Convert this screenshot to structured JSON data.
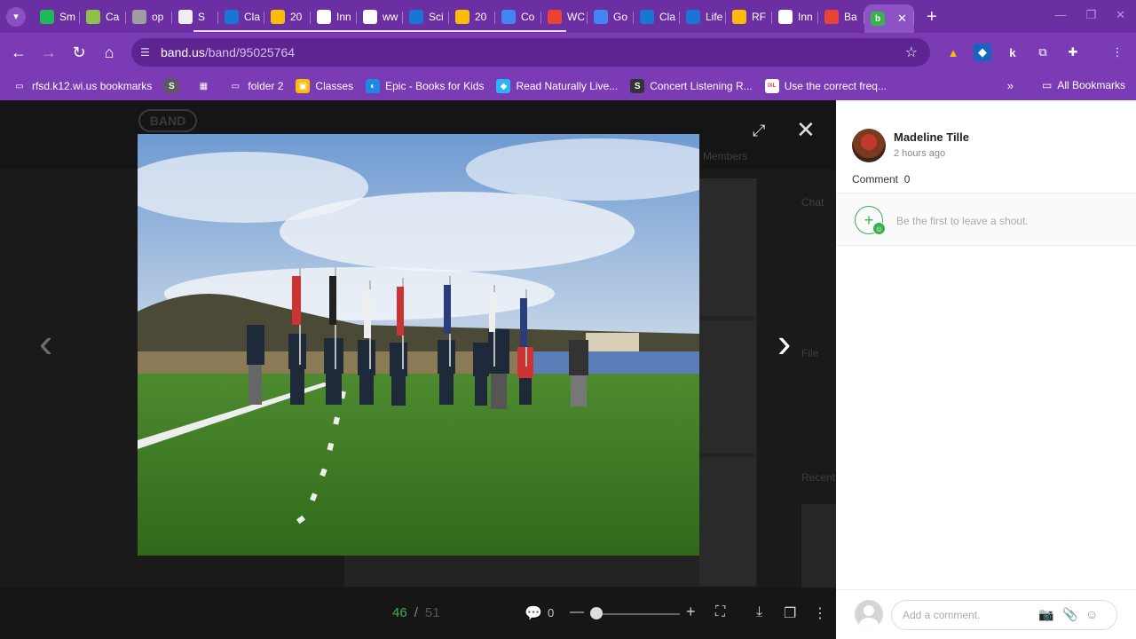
{
  "browser": {
    "tabs": [
      {
        "title": "Sm",
        "favicon": "green-s-icon",
        "color": "#1db954"
      },
      {
        "title": "Ca",
        "favicon": "canva-c-icon",
        "color": "#8bc34a"
      },
      {
        "title": "op",
        "favicon": "spotify-icon",
        "color": "#9e9e9e"
      },
      {
        "title": "S",
        "favicon": "s-icon",
        "color": "#eeeeee"
      },
      {
        "title": "Cla",
        "favicon": "pearson-p-icon",
        "color": "#1976d2"
      },
      {
        "title": "20",
        "favicon": "drive-icon",
        "color": "#fbbc04"
      },
      {
        "title": "Inn",
        "favicon": "panda-icon",
        "color": "#ffffff"
      },
      {
        "title": "ww",
        "favicon": "n-icon",
        "color": "#ffffff"
      },
      {
        "title": "Sci",
        "favicon": "pearson-p-icon",
        "color": "#1976d2"
      },
      {
        "title": "20",
        "favicon": "drive-icon",
        "color": "#fbbc04"
      },
      {
        "title": "Co",
        "favicon": "docs-icon",
        "color": "#4285f4"
      },
      {
        "title": "WC",
        "favicon": "gmail-icon",
        "color": "#ea4335"
      },
      {
        "title": "Go",
        "favicon": "docs-icon",
        "color": "#4285f4"
      },
      {
        "title": "Cla",
        "favicon": "pearson-p-icon",
        "color": "#1976d2"
      },
      {
        "title": "Life",
        "favicon": "pearson-p-icon",
        "color": "#1976d2"
      },
      {
        "title": "RF",
        "favicon": "slides-icon",
        "color": "#fbbc04"
      },
      {
        "title": "Inn",
        "favicon": "panda-icon",
        "color": "#ffffff"
      },
      {
        "title": "Ba",
        "favicon": "gmail-icon",
        "color": "#ea4335"
      }
    ],
    "active_tab": {
      "title": "b",
      "favicon": "band-icon",
      "color": "#37b24d"
    },
    "url_host": "band.us",
    "url_path": "/band/95025764",
    "bookmarks": [
      {
        "label": "rfsd.k12.wi.us bookmarks",
        "icon": "managed-folder-icon"
      },
      {
        "label": "",
        "icon": "s-icon"
      },
      {
        "label": "",
        "icon": "apps-grid-icon"
      },
      {
        "label": "folder 2",
        "icon": "folder-icon"
      },
      {
        "label": "Classes",
        "icon": "classroom-icon"
      },
      {
        "label": "Epic - Books for Kids",
        "icon": "epic-icon"
      },
      {
        "label": "Read Naturally Live...",
        "icon": "read-naturally-icon"
      },
      {
        "label": "Concert Listening R...",
        "icon": "s-circle-icon"
      },
      {
        "label": "Use the correct freq...",
        "icon": "ixl-icon"
      }
    ],
    "all_bookmarks": "All Bookmarks"
  },
  "page": {
    "bg_logo": "BAND",
    "bg_members": "Members",
    "bg_chat": "Chat",
    "bg_file": "File",
    "bg_recent": "Recent"
  },
  "viewer": {
    "current": "46",
    "separator": "/",
    "total": "51",
    "comment_count": "0",
    "zoom_level": 0.0
  },
  "post": {
    "author": "Madeline Tille",
    "time": "2 hours ago",
    "comment_label": "Comment",
    "comment_count": "0",
    "shout_placeholder": "Be the first to leave a shout.",
    "comment_placeholder": "Add a comment."
  }
}
